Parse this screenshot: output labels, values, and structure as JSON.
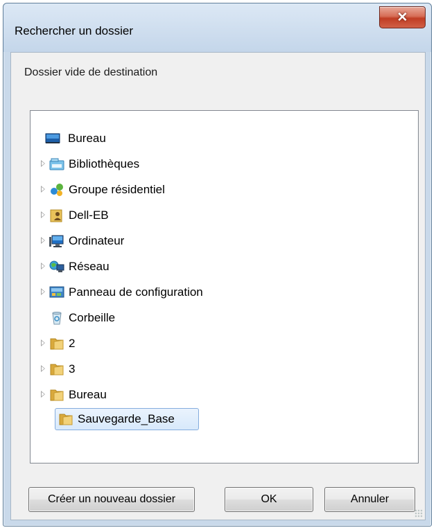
{
  "window": {
    "title": "Rechercher un dossier",
    "close_label": "✕",
    "instruction": "Dossier vide de destination"
  },
  "tree": {
    "items": [
      {
        "label": "Bureau",
        "icon": "desktop-icon",
        "expandable": false
      },
      {
        "label": "Bibliothèques",
        "icon": "libraries-icon",
        "expandable": true
      },
      {
        "label": "Groupe résidentiel",
        "icon": "homegroup-icon",
        "expandable": true
      },
      {
        "label": "Dell-EB",
        "icon": "user-folder-icon",
        "expandable": true
      },
      {
        "label": "Ordinateur",
        "icon": "computer-icon",
        "expandable": true
      },
      {
        "label": "Réseau",
        "icon": "network-icon",
        "expandable": true
      },
      {
        "label": "Panneau de configuration",
        "icon": "control-panel-icon",
        "expandable": true
      },
      {
        "label": "Corbeille",
        "icon": "recycle-bin-icon",
        "expandable": false
      },
      {
        "label": "2",
        "icon": "folder-icon",
        "expandable": true
      },
      {
        "label": "3",
        "icon": "folder-icon",
        "expandable": true
      },
      {
        "label": "Bureau",
        "icon": "folder-icon",
        "expandable": true
      },
      {
        "label": "Sauvegarde_Base",
        "icon": "folder-icon",
        "expandable": false,
        "selected": true
      }
    ]
  },
  "buttons": {
    "new_folder": "Créer un nouveau dossier",
    "ok": "OK",
    "cancel": "Annuler"
  },
  "colors": {
    "selection_border": "#84acdd",
    "selection_fill": "#d8e9fb",
    "close_button": "#c03d24",
    "folder": "#e8c25a"
  }
}
